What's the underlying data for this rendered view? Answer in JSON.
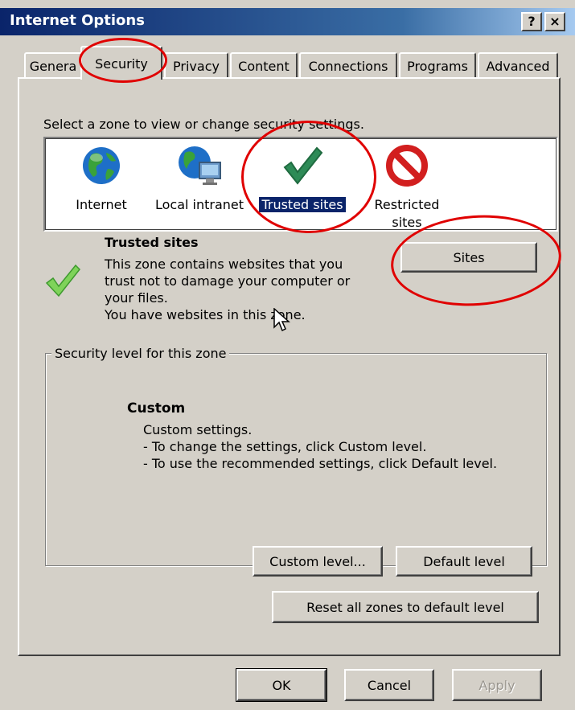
{
  "window": {
    "title": "Internet Options",
    "help_label": "?",
    "close_label": "×"
  },
  "tabs": [
    {
      "label": "General",
      "shown": "Genera"
    },
    {
      "label": "Security"
    },
    {
      "label": "Privacy"
    },
    {
      "label": "Content"
    },
    {
      "label": "Connections"
    },
    {
      "label": "Programs"
    },
    {
      "label": "Advanced"
    }
  ],
  "zones": {
    "instruction": "Select a zone to view or change security settings.",
    "items": [
      {
        "label": "Internet",
        "icon": "globe-icon"
      },
      {
        "label": "Local intranet",
        "shown": "Local intranet",
        "icon": "intranet-icon"
      },
      {
        "label": "Trusted sites",
        "icon": "checkmark-icon"
      },
      {
        "label_line1": "Restricted",
        "label_line2": "sites",
        "icon": "restricted-icon"
      }
    ]
  },
  "zone_info": {
    "title": "Trusted sites",
    "description_lines": [
      "This zone contains websites that you",
      "trust not to damage your computer or",
      "your files.",
      "You have websites in this zone."
    ],
    "sites_button": "Sites"
  },
  "security_level": {
    "group_title": "Security level for this zone",
    "level_title": "Custom",
    "lines": [
      "Custom settings.",
      "- To change the settings, click Custom level.",
      "- To use the recommended settings, click Default level."
    ],
    "custom_button": "Custom level...",
    "default_button": "Default level"
  },
  "reset_button": "Reset all zones to default level",
  "footer": {
    "ok": "OK",
    "cancel": "Cancel",
    "apply": "Apply"
  },
  "colors": {
    "title_bar": "#0a246a",
    "dialog_bg": "#d4d0c8",
    "selection": "#0a246a",
    "annotation_red": "#e00000",
    "check_green": "#2e8b57"
  }
}
